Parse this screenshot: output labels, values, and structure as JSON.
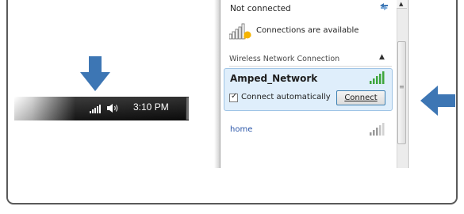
{
  "taskbar": {
    "time": "3:10 PM",
    "icons": [
      "wifi-signal-icon",
      "speaker-icon"
    ]
  },
  "network_panel": {
    "status": "Not connected",
    "availability": "Connections are available",
    "section_header": "Wireless Network Connection",
    "selected_network": {
      "name": "Amped_Network",
      "auto_connect_label": "Connect automatically",
      "auto_connect_checked": true,
      "connect_button": "Connect",
      "checkmark": "✓"
    },
    "other_networks": [
      {
        "name": "home"
      }
    ],
    "scroll_arrow": "▲",
    "collapse_chevron": "▲",
    "scroll_grip": "≡"
  },
  "colors": {
    "arrow_blue": "#3d76b4",
    "signal_green": "#3fa63c",
    "link_blue": "#2a55a8",
    "selection_bg": "#dfeefb"
  }
}
